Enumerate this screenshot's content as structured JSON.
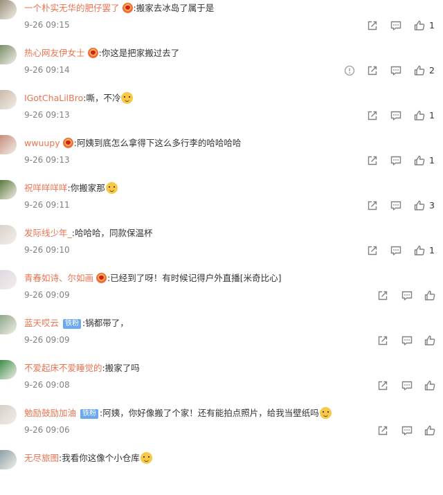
{
  "colors": {
    "username": "#eb7350",
    "time": "#808080",
    "fan_badge": "#6aa8f0"
  },
  "comments": [
    {
      "user": "一个朴实无华的肥仔罢了",
      "vip": true,
      "fan": "",
      "sep": ":",
      "text": "搬家去冰岛了属于是",
      "emoji": false,
      "time": "9-26 09:15",
      "likes": "1",
      "report": false,
      "avatar_color": "#9c8f7a"
    },
    {
      "user": "热心网友伊女士",
      "vip": true,
      "fan": "",
      "sep": ":",
      "text": "你这是把家搬过去了",
      "emoji": false,
      "time": "9-26 09:14",
      "likes": "2",
      "report": true,
      "avatar_color": "#7b8f6a"
    },
    {
      "user": "IGotChaLilBro",
      "vip": false,
      "fan": "",
      "sep": ":",
      "text": "嘶，不冷",
      "emoji": true,
      "time": "9-26 09:13",
      "likes": "1",
      "report": false,
      "avatar_color": "#c9b9a8"
    },
    {
      "user": "wwuupy",
      "vip": true,
      "fan": "",
      "sep": ":",
      "text": "阿姨到底怎么拿得下这么多行李的哈哈哈哈",
      "emoji": false,
      "time": "9-26 09:13",
      "likes": "1",
      "report": false,
      "avatar_color": "#c98e7e"
    },
    {
      "user": "祝咩咩咩咩",
      "vip": false,
      "fan": "",
      "sep": ":",
      "text": "你搬家那",
      "emoji": true,
      "time": "9-26 09:11",
      "likes": "3",
      "report": false,
      "avatar_color": "#5d7a3f"
    },
    {
      "user": "发际线少年_",
      "vip": false,
      "fan": "",
      "sep": ":",
      "text": "哈哈哈，同款保温杯",
      "emoji": false,
      "time": "9-26 09:10",
      "likes": "1",
      "report": false,
      "avatar_color": "#d9d3cc"
    },
    {
      "user": "青春如诗、尔如画",
      "vip": true,
      "fan": "",
      "sep": ":",
      "text": "已经到了呀！有时候记得户外直播[米奇比心]",
      "emoji": false,
      "time": "9-26 09:09",
      "likes": "",
      "report": false,
      "avatar_color": "#e0d8e3"
    },
    {
      "user": "蓝天哎云",
      "vip": false,
      "fan": "铁粉",
      "sep": ":",
      "text": "锅都带了，",
      "emoji": false,
      "time": "9-26 09:09",
      "likes": "",
      "report": false,
      "avatar_color": "#8fa889"
    },
    {
      "user": "不爱起床不爱睡觉的",
      "vip": false,
      "fan": "",
      "sep": ":",
      "text": "搬家了吗",
      "emoji": false,
      "time": "9-26 09:08",
      "likes": "",
      "report": false,
      "avatar_color": "#3f8f4a"
    },
    {
      "user": "勉励鼓励加油",
      "vip": false,
      "fan": "铁粉",
      "sep": ":",
      "text": "阿姨，你好像搬了个家！还有能拍点照片，给我当壁纸吗",
      "emoji": true,
      "time": "9-26 09:06",
      "likes": "",
      "report": false,
      "avatar_color": "#d6cfc7"
    },
    {
      "user": "无尽旅图",
      "vip": false,
      "fan": "",
      "sep": ":",
      "text": "我看你这像个小仓库",
      "emoji": true,
      "time": "",
      "likes": "",
      "report": false,
      "avatar_color": "#8da0a8"
    }
  ]
}
